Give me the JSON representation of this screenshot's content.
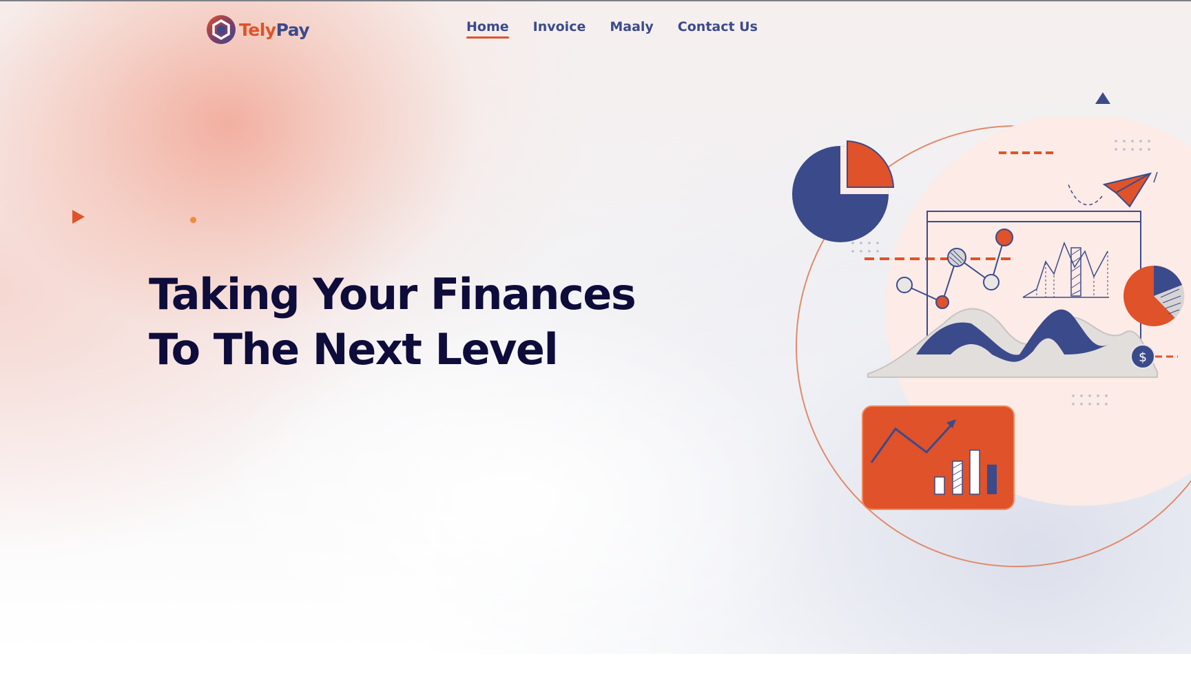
{
  "brand": {
    "name_part1": "Tely",
    "name_part2": "Pay",
    "logo_icon": "hexagon-logo-icon",
    "colors": {
      "accent_orange": "#e0522a",
      "brand_navy": "#3b4a8a",
      "headline_dark": "#0e0c3a"
    }
  },
  "nav": {
    "items": [
      {
        "label": "Home",
        "active": true
      },
      {
        "label": "Invoice",
        "active": false
      },
      {
        "label": "Maaly",
        "active": false
      },
      {
        "label": "Contact Us",
        "active": false
      }
    ]
  },
  "hero": {
    "headline_line1": "Taking Your Finances",
    "headline_line2": "To The Next Level",
    "illustration_icons": [
      "pie-chart-icon",
      "paper-plane-icon",
      "line-chart-icon",
      "dollar-coin-icon",
      "bar-chart-card-icon"
    ],
    "illustration_coin_symbol": "$"
  }
}
